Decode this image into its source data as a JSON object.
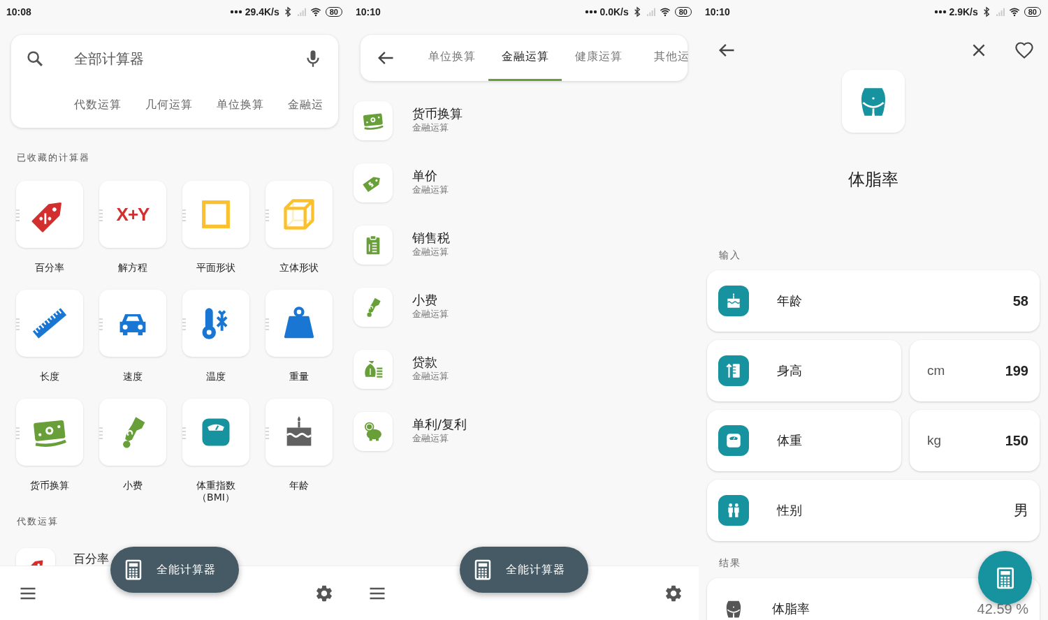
{
  "home": {
    "status_bar": {
      "time": "10:08",
      "speed": "29.4K/s",
      "battery": "80"
    },
    "search": {
      "placeholder": "全部计算器"
    },
    "categories": [
      "代数运算",
      "几何运算",
      "单位换算",
      "金融运"
    ],
    "favorites_title": "已收藏的计算器",
    "favorites": [
      {
        "label": "百分率"
      },
      {
        "label": "解方程",
        "icon_text": "X+Y"
      },
      {
        "label": "平面形状"
      },
      {
        "label": "立体形状"
      },
      {
        "label": "长度"
      },
      {
        "label": "速度"
      },
      {
        "label": "温度"
      },
      {
        "label": "重量"
      },
      {
        "label": "货币换算"
      },
      {
        "label": "小费"
      },
      {
        "label": "体重指数（BMI）"
      },
      {
        "label": "年龄"
      }
    ],
    "section_title": "代数运算",
    "list": [
      {
        "title": "百分率"
      }
    ],
    "fab": "全能计算器"
  },
  "category": {
    "status_bar": {
      "time": "10:10",
      "speed": "0.0K/s",
      "battery": "80"
    },
    "tabs": [
      {
        "label": "单位换算",
        "selected": false
      },
      {
        "label": "金融运算",
        "selected": true
      },
      {
        "label": "健康运算",
        "selected": false
      },
      {
        "label": "其他运",
        "selected": false
      }
    ],
    "items": [
      {
        "title": "货币换算",
        "subtitle": "金融运算"
      },
      {
        "title": "单价",
        "subtitle": "金融运算"
      },
      {
        "title": "销售税",
        "subtitle": "金融运算"
      },
      {
        "title": "小费",
        "subtitle": "金融运算"
      },
      {
        "title": "贷款",
        "subtitle": "金融运算"
      },
      {
        "title": "单利/复利",
        "subtitle": "金融运算"
      }
    ],
    "fab": "全能计算器"
  },
  "detail": {
    "status_bar": {
      "time": "10:10",
      "speed": "2.9K/s",
      "battery": "80"
    },
    "title": "体脂率",
    "input_title": "输入",
    "inputs": [
      {
        "kind": "number",
        "label": "年龄",
        "value": "58"
      },
      {
        "kind": "number",
        "label": "身高",
        "unit": "cm",
        "value": "199"
      },
      {
        "kind": "number",
        "label": "体重",
        "unit": "kg",
        "value": "150"
      },
      {
        "kind": "choice",
        "label": "性别",
        "value": "男"
      }
    ],
    "result_title": "结果",
    "result": {
      "label": "体脂率",
      "value": "42.59 %"
    }
  }
}
